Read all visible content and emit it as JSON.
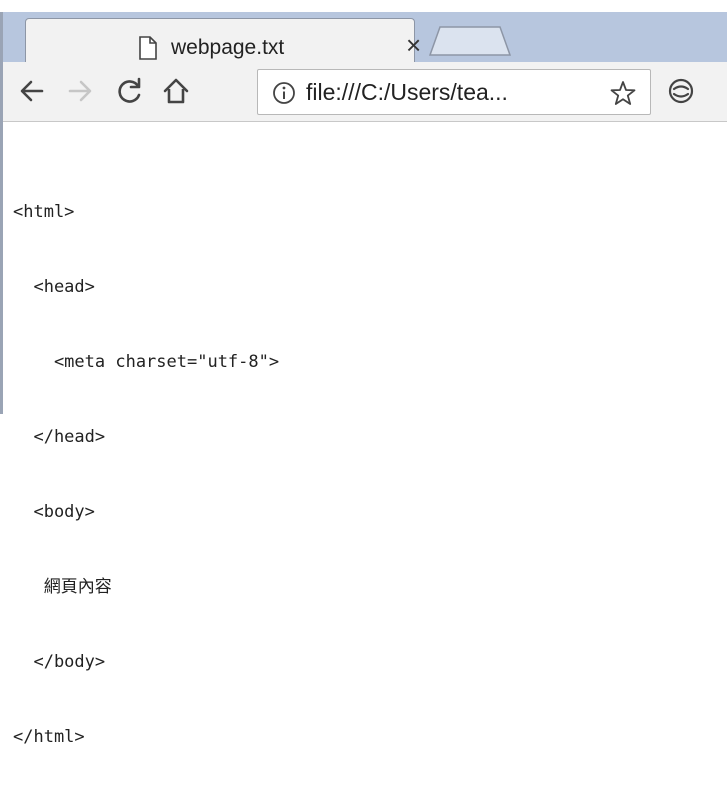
{
  "tab": {
    "title": "webpage.txt",
    "close_glyph": "×"
  },
  "icons": {
    "favicon": "document-icon",
    "back": "back-arrow-icon",
    "forward": "forward-arrow-icon",
    "reload": "reload-icon",
    "home": "home-icon",
    "info": "info-icon",
    "bookmark": "star-icon",
    "extension": "extension-icon"
  },
  "address_bar": {
    "url": "file:///C:/Users/tea..."
  },
  "content": {
    "lines": [
      "<html>",
      "  <head>",
      "    <meta charset=\"utf-8\">",
      "  </head>",
      "  <body>",
      "   網頁內容",
      "  </body>",
      "</html>"
    ]
  },
  "colors": {
    "tabbar": "#b7c6de",
    "toolbar": "#f2f2f2",
    "forward_disabled": "#c6c6c6"
  }
}
